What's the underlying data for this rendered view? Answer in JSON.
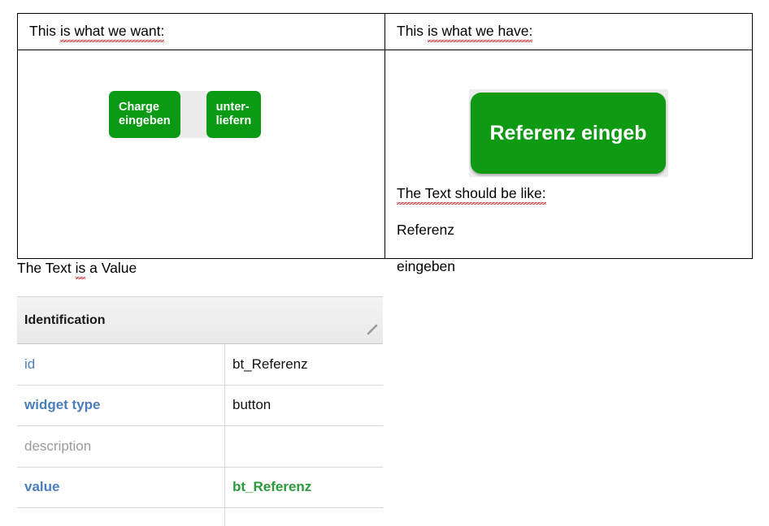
{
  "comparison": {
    "left_header": "This is what we want:",
    "left_header_parts": {
      "plain": "This ",
      "misspelled": "is what we want:"
    },
    "right_header": "This is what we have:",
    "right_header_parts": {
      "plain": "This ",
      "misspelled": "is what we have:"
    },
    "want_buttons": [
      {
        "label": "Charge\neingeben"
      },
      {
        "label": "unter-\nliefern"
      }
    ],
    "have_button": {
      "label": "Referenz eingeb",
      "full_label": "Referenz eingeben",
      "clipped": true
    },
    "notes": {
      "line1_plain": "The Text ",
      "line1_misspelled": "should be",
      "line1_tail": " like:",
      "line2": "Referenz",
      "line3": "eingeben"
    }
  },
  "caption": {
    "plain_before": "The Text ",
    "misspelled": "is",
    "plain_after": " a Value"
  },
  "properties": {
    "section_title": "Identification",
    "grip_icon": "resize-grip-icon",
    "rows": [
      {
        "key": "id",
        "value": "bt_Referenz",
        "key_style": "k-blue",
        "value_style": "v-black"
      },
      {
        "key": "widget type",
        "value": "button",
        "key_style": "k-bold",
        "value_style": "v-black"
      },
      {
        "key": "description",
        "value": "",
        "key_style": "k-gray",
        "value_style": "v-black"
      },
      {
        "key": "value",
        "value": "bt_Referenz",
        "key_style": "k-bold",
        "value_style": "v-green"
      }
    ]
  },
  "colors": {
    "button_green": "#0e9a13",
    "button_text": "#ffffff",
    "button_backdrop": "#ececec",
    "key_blue": "#4a7ebb",
    "key_gray": "#9b9b9b",
    "value_green": "#2a9b3c",
    "header_gray": "#eeeeee",
    "spellcheck_red": "#e01b1b",
    "table_border": "#000000"
  }
}
